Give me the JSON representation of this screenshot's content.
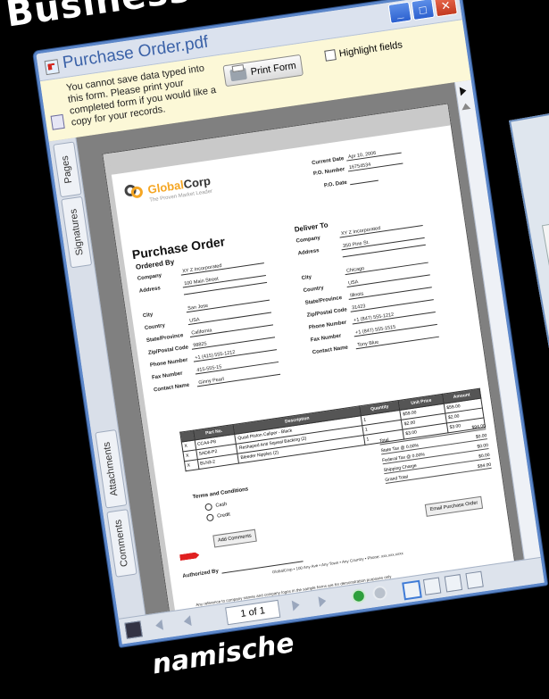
{
  "headline_top": "Business Logik",
  "headline_bottom": "namische",
  "window": {
    "title": "Purchase Order.pdf",
    "buttons": {
      "minimize": "_",
      "maximize": "□",
      "close": "✕"
    }
  },
  "infobar": {
    "message": "You cannot save data typed into this form. Please print your completed form if you would like a copy for your records.",
    "print_button": "Print Form",
    "highlight_label": "Highlight fields"
  },
  "side_tabs": [
    "Pages",
    "Signatures",
    "Attachments",
    "Comments"
  ],
  "document": {
    "logo_brand_a": "Global",
    "logo_brand_b": "Corp",
    "logo_tagline": "The Proven Market Leader",
    "header_fields": [
      {
        "label": "Current Date",
        "value": "Apr 10, 2006"
      },
      {
        "label": "P.O. Number",
        "value": "16754534"
      },
      {
        "label": "P.O. Date",
        "value": ""
      }
    ],
    "title": "Purchase Order",
    "ordered_by": {
      "heading": "Ordered By",
      "fields": [
        {
          "label": "Company",
          "value": "XY Z Incorporated"
        },
        {
          "label": "Address",
          "value": "100 Main Street"
        },
        {
          "label": "",
          "value": ""
        },
        {
          "label": "City",
          "value": "San Jose"
        },
        {
          "label": "Country",
          "value": "USA"
        },
        {
          "label": "State/Province",
          "value": "California"
        },
        {
          "label": "Zip/Postal Code",
          "value": "98825"
        },
        {
          "label": "Phone Number",
          "value": "+1 (415) 555-1212"
        },
        {
          "label": "Fax Number",
          "value": "415-555-15"
        },
        {
          "label": "Contact Name",
          "value": "Ginny Pearl"
        }
      ]
    },
    "deliver_to": {
      "heading": "Deliver To",
      "fields": [
        {
          "label": "Company",
          "value": "XY Z Incorporated"
        },
        {
          "label": "Address",
          "value": "350 Pine St."
        },
        {
          "label": "",
          "value": ""
        },
        {
          "label": "City",
          "value": "Chicago"
        },
        {
          "label": "Country",
          "value": "USA"
        },
        {
          "label": "State/Province",
          "value": "Illinois"
        },
        {
          "label": "Zip/Postal Code",
          "value": "31423"
        },
        {
          "label": "Phone Number",
          "value": "+1 (847) 555-1212"
        },
        {
          "label": "Fax Number",
          "value": "+1 (847) 555-1515"
        },
        {
          "label": "Contact Name",
          "value": "Tony Blue"
        }
      ]
    },
    "table": {
      "headers": [
        "",
        "Part No.",
        "Description",
        "Quantity",
        "Unit Price",
        "Amount"
      ],
      "rows": [
        [
          "X",
          "CCA4-P8",
          "Quad Piston Caliper - Black",
          "1",
          "$59.00",
          "$59.00"
        ],
        [
          "X",
          "SAD8-P2",
          "Reshaped Anti Squeal Backing (2)",
          "1",
          "$2.00",
          "$2.00"
        ],
        [
          "X",
          "BLN3-2",
          "Bleeder Nipples (2)",
          "1",
          "$3.00",
          "$3.00"
        ]
      ],
      "totals": [
        {
          "label": "Total",
          "value": "$94.00"
        },
        {
          "label": "State Tax @ 0.00%",
          "value": "$0.00"
        },
        {
          "label": "Federal Tax @ 0.00%",
          "value": "$0.00"
        },
        {
          "label": "Shipping Charge",
          "value": "$0.00"
        },
        {
          "label": "Grand Total",
          "value": "$94.00"
        }
      ]
    },
    "terms_heading": "Terms and Conditions",
    "terms_options": [
      "Cash",
      "Credit"
    ],
    "add_comments_button": "Add Comments",
    "email_button": "Email Purchase Order",
    "authorized_label": "Authorized By",
    "footer_line1": "GlobalCorp • 100 Any Ave • Any Town • Any Country • Phone: xxx.xxx.xxxx",
    "footer_line2": "Any reference to company names and company logos in the sample forms are for demonstration purposes only"
  },
  "navbar": {
    "page_indicator": "1 of 1"
  }
}
